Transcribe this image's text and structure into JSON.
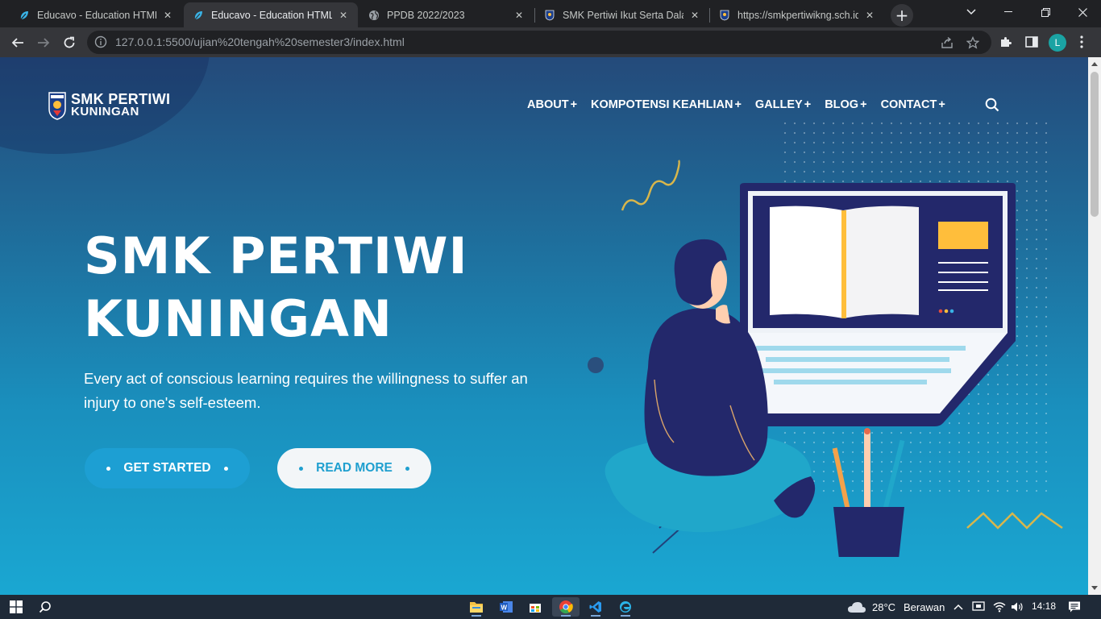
{
  "browser": {
    "tabs": [
      {
        "title": "Educavo - Education HTML Te",
        "favicon": "educavo-leaf-icon",
        "active": false
      },
      {
        "title": "Educavo - Education HTML Te",
        "favicon": "educavo-leaf-icon",
        "active": true
      },
      {
        "title": "PPDB 2022/2023",
        "favicon": "globe-icon",
        "active": false
      },
      {
        "title": "SMK Pertiwi Ikut Serta Dalam",
        "favicon": "school-emblem-icon",
        "active": false
      },
      {
        "title": "https://smkpertiwikng.sch.id",
        "favicon": "school-emblem-icon",
        "active": false
      }
    ],
    "tab_close_glyph": "✕",
    "new_tab_glyph": "+",
    "url": "127.0.0.1:5500/ujian%20tengah%20semester3/index.html",
    "profile_initial": "L"
  },
  "site": {
    "logo": {
      "line1": "SMK PERTIWI",
      "line2": "KUNINGAN"
    },
    "nav": [
      {
        "label": "ABOUT",
        "suffix": "+"
      },
      {
        "label": "KOMPOTENSI KEAHLIAN",
        "suffix": "+"
      },
      {
        "label": "GALLEY",
        "suffix": "+"
      },
      {
        "label": "BLOG",
        "suffix": "+"
      },
      {
        "label": "CONTACT",
        "suffix": "+"
      }
    ],
    "hero": {
      "title_line1": "SMK PERTIWI",
      "title_line2": "KUNINGAN",
      "subtitle": "Every act of conscious learning requires the willingness to suffer an injury to one's self-esteem.",
      "primary_button": "GET STARTED",
      "secondary_button": "READ MORE"
    },
    "colors": {
      "accent": "#1d9fd3",
      "dark_navy": "#23286b",
      "yellow": "#ffbe3b"
    }
  },
  "taskbar": {
    "weather_temp": "28°C",
    "weather_desc": "Berawan",
    "time": "14:18"
  }
}
